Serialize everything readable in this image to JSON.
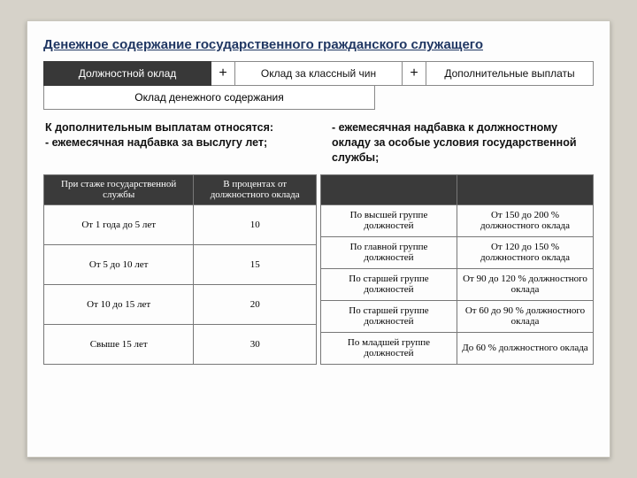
{
  "title": "Денежное содержание государственного гражданского служащего",
  "formula": {
    "box1": "Должностной оклад",
    "plus1": "+",
    "box2": "Оклад за классный чин",
    "plus2": "+",
    "box3": "Дополнительные выплаты",
    "subbox": "Оклад денежного содержания"
  },
  "col_left": "К дополнительным выплатам относятся:\n- ежемесячная надбавка за выслугу лет;",
  "col_right": "- ежемесячная надбавка к должностному окладу за особые условия государственной службы;",
  "table_left": {
    "headers": [
      "При стаже государственной службы",
      "В процентах от должностного оклада"
    ],
    "rows": [
      [
        "От 1 года до 5 лет",
        "10"
      ],
      [
        "От 5 до 10 лет",
        "15"
      ],
      [
        "От 10 до 15 лет",
        "20"
      ],
      [
        "Свыше 15 лет",
        "30"
      ]
    ]
  },
  "table_right": {
    "headers": [
      "",
      ""
    ],
    "rows": [
      [
        "По высшей группе должностей",
        "От 150 до 200 % должностного оклада"
      ],
      [
        "По главной группе должностей",
        "От 120 до 150 % должностного оклада"
      ],
      [
        "По старшей группе должностей",
        "От 90 до 120 % должностного оклада"
      ],
      [
        "По старшей группе должностей",
        "От 60 до 90 % должностного оклада"
      ],
      [
        "По младшей группе должностей",
        "До 60 % должностного оклада"
      ]
    ]
  }
}
